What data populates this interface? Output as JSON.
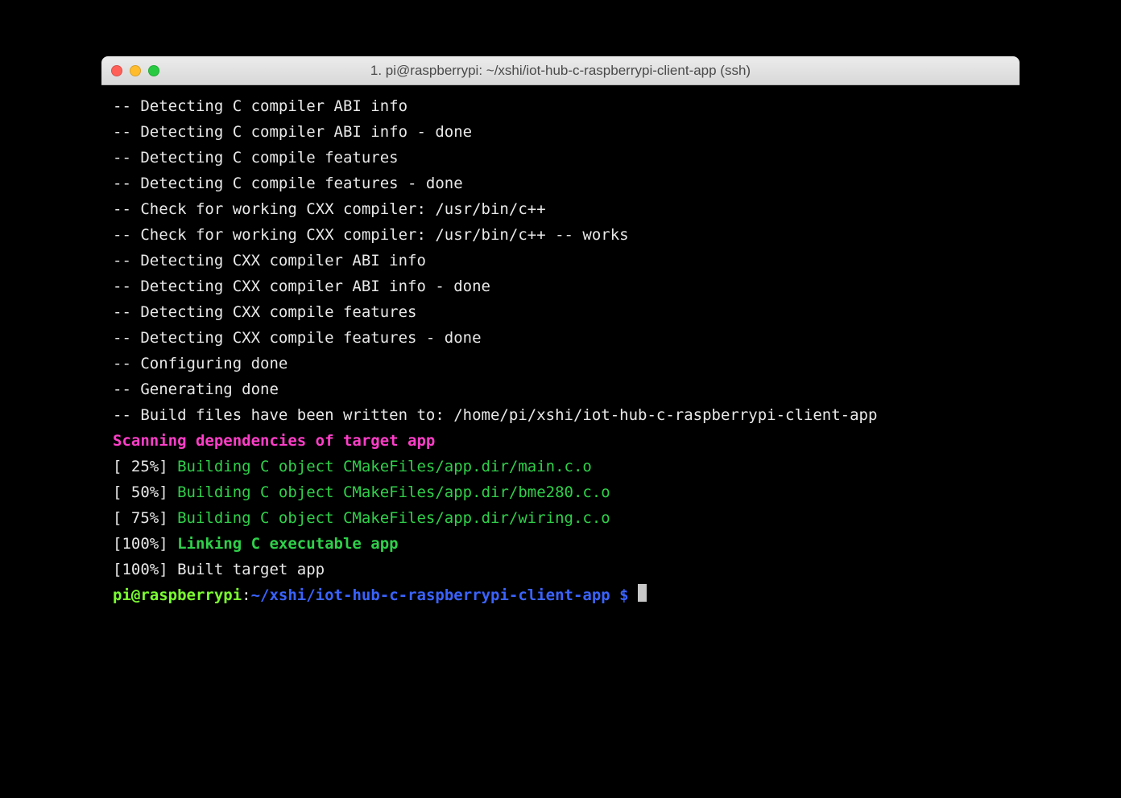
{
  "window": {
    "title": "1. pi@raspberrypi: ~/xshi/iot-hub-c-raspberrypi-client-app (ssh)"
  },
  "lines": {
    "l0": "-- Detecting C compiler ABI info",
    "l1": "-- Detecting C compiler ABI info - done",
    "l2": "-- Detecting C compile features",
    "l3": "-- Detecting C compile features - done",
    "l4": "-- Check for working CXX compiler: /usr/bin/c++",
    "l5": "-- Check for working CXX compiler: /usr/bin/c++ -- works",
    "l6": "-- Detecting CXX compiler ABI info",
    "l7": "-- Detecting CXX compiler ABI info - done",
    "l8": "-- Detecting CXX compile features",
    "l9": "-- Detecting CXX compile features - done",
    "l10": "-- Configuring done",
    "l11": "-- Generating done",
    "l12": "-- Build files have been written to: /home/pi/xshi/iot-hub-c-raspberrypi-client-app",
    "scan": "Scanning dependencies of target app",
    "p25": "[ 25%] ",
    "p50": "[ 50%] ",
    "p75": "[ 75%] ",
    "p100a": "[100%] ",
    "p100b": "[100%] ",
    "b25": "Building C object CMakeFiles/app.dir/main.c.o",
    "b50": "Building C object CMakeFiles/app.dir/bme280.c.o",
    "b75": "Building C object CMakeFiles/app.dir/wiring.c.o",
    "link": "Linking C executable app",
    "built": "Built target app",
    "prompt_user": "pi@raspberrypi",
    "prompt_colon": ":",
    "prompt_path": "~/xshi/iot-hub-c-raspberrypi-client-app $ "
  }
}
